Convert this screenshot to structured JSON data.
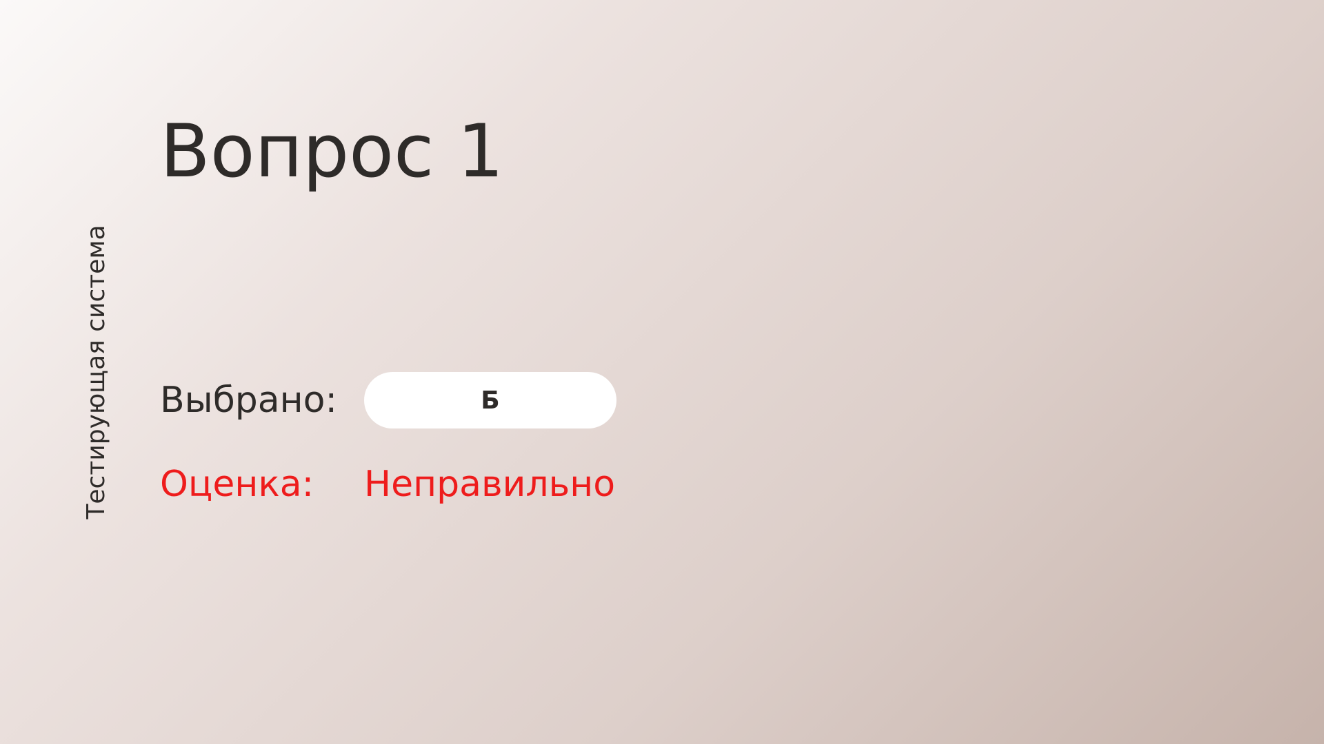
{
  "app": {
    "side_label": "Тестирующая система"
  },
  "question": {
    "title": "Вопрос 1"
  },
  "result": {
    "selected_label": "Выбрано:",
    "selected_value": "Б",
    "score_label": "Оценка:",
    "score_value": "Неправильно"
  },
  "colors": {
    "text": "#2e2b29",
    "error": "#ee1c1c",
    "pill_background": "#ffffff"
  }
}
